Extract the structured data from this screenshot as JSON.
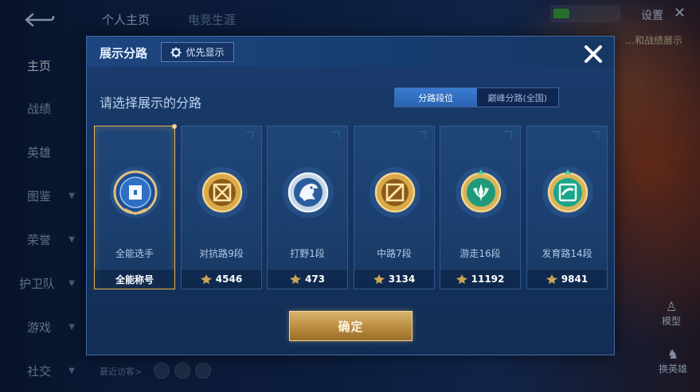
{
  "background": {
    "top_tabs": [
      "个人主页",
      "电竞生涯"
    ],
    "settings_label": "设置",
    "nav_items": [
      {
        "label": "主页",
        "active": true,
        "has_arrow": false
      },
      {
        "label": "战绩",
        "active": false,
        "has_arrow": false
      },
      {
        "label": "英雄",
        "active": false,
        "has_arrow": false
      },
      {
        "label": "图鉴",
        "active": false,
        "has_arrow": true
      },
      {
        "label": "荣誉",
        "active": false,
        "has_arrow": true
      },
      {
        "label": "护卫队",
        "active": false,
        "has_arrow": true
      },
      {
        "label": "游戏",
        "active": false,
        "has_arrow": true
      },
      {
        "label": "社交",
        "active": false,
        "has_arrow": true
      }
    ],
    "recent_visitors_label": "最近访客>",
    "hint_text": "...和战绩展示",
    "model_label": "模型",
    "change_hero_label": "换英雄"
  },
  "dialog": {
    "title": "展示分路",
    "priority_label": "优先显示",
    "subtitle": "请选择展示的分路",
    "segment": {
      "options": [
        "分路段位",
        "巅峰分路(全国)"
      ],
      "selected": 0
    },
    "confirm_label": "确定",
    "colors": {
      "gold": "#e6b24e",
      "accent_blue": "#2a63b3"
    }
  },
  "cards": [
    {
      "name": "全能选手",
      "footer": "全能称号",
      "selected": true,
      "icon": "all-round-badge-icon",
      "show_points": false
    },
    {
      "name": "对抗路9段",
      "footer": "4546",
      "selected": false,
      "icon": "clash-lane-badge-icon",
      "show_points": true
    },
    {
      "name": "打野1段",
      "footer": "473",
      "selected": false,
      "icon": "jungle-badge-icon",
      "show_points": true
    },
    {
      "name": "中路7段",
      "footer": "3134",
      "selected": false,
      "icon": "mid-lane-badge-icon",
      "show_points": true
    },
    {
      "name": "游走16段",
      "footer": "11192",
      "selected": false,
      "icon": "roam-badge-icon",
      "show_points": true
    },
    {
      "name": "发育路14段",
      "footer": "9841",
      "selected": false,
      "icon": "farm-lane-badge-icon",
      "show_points": true
    }
  ]
}
